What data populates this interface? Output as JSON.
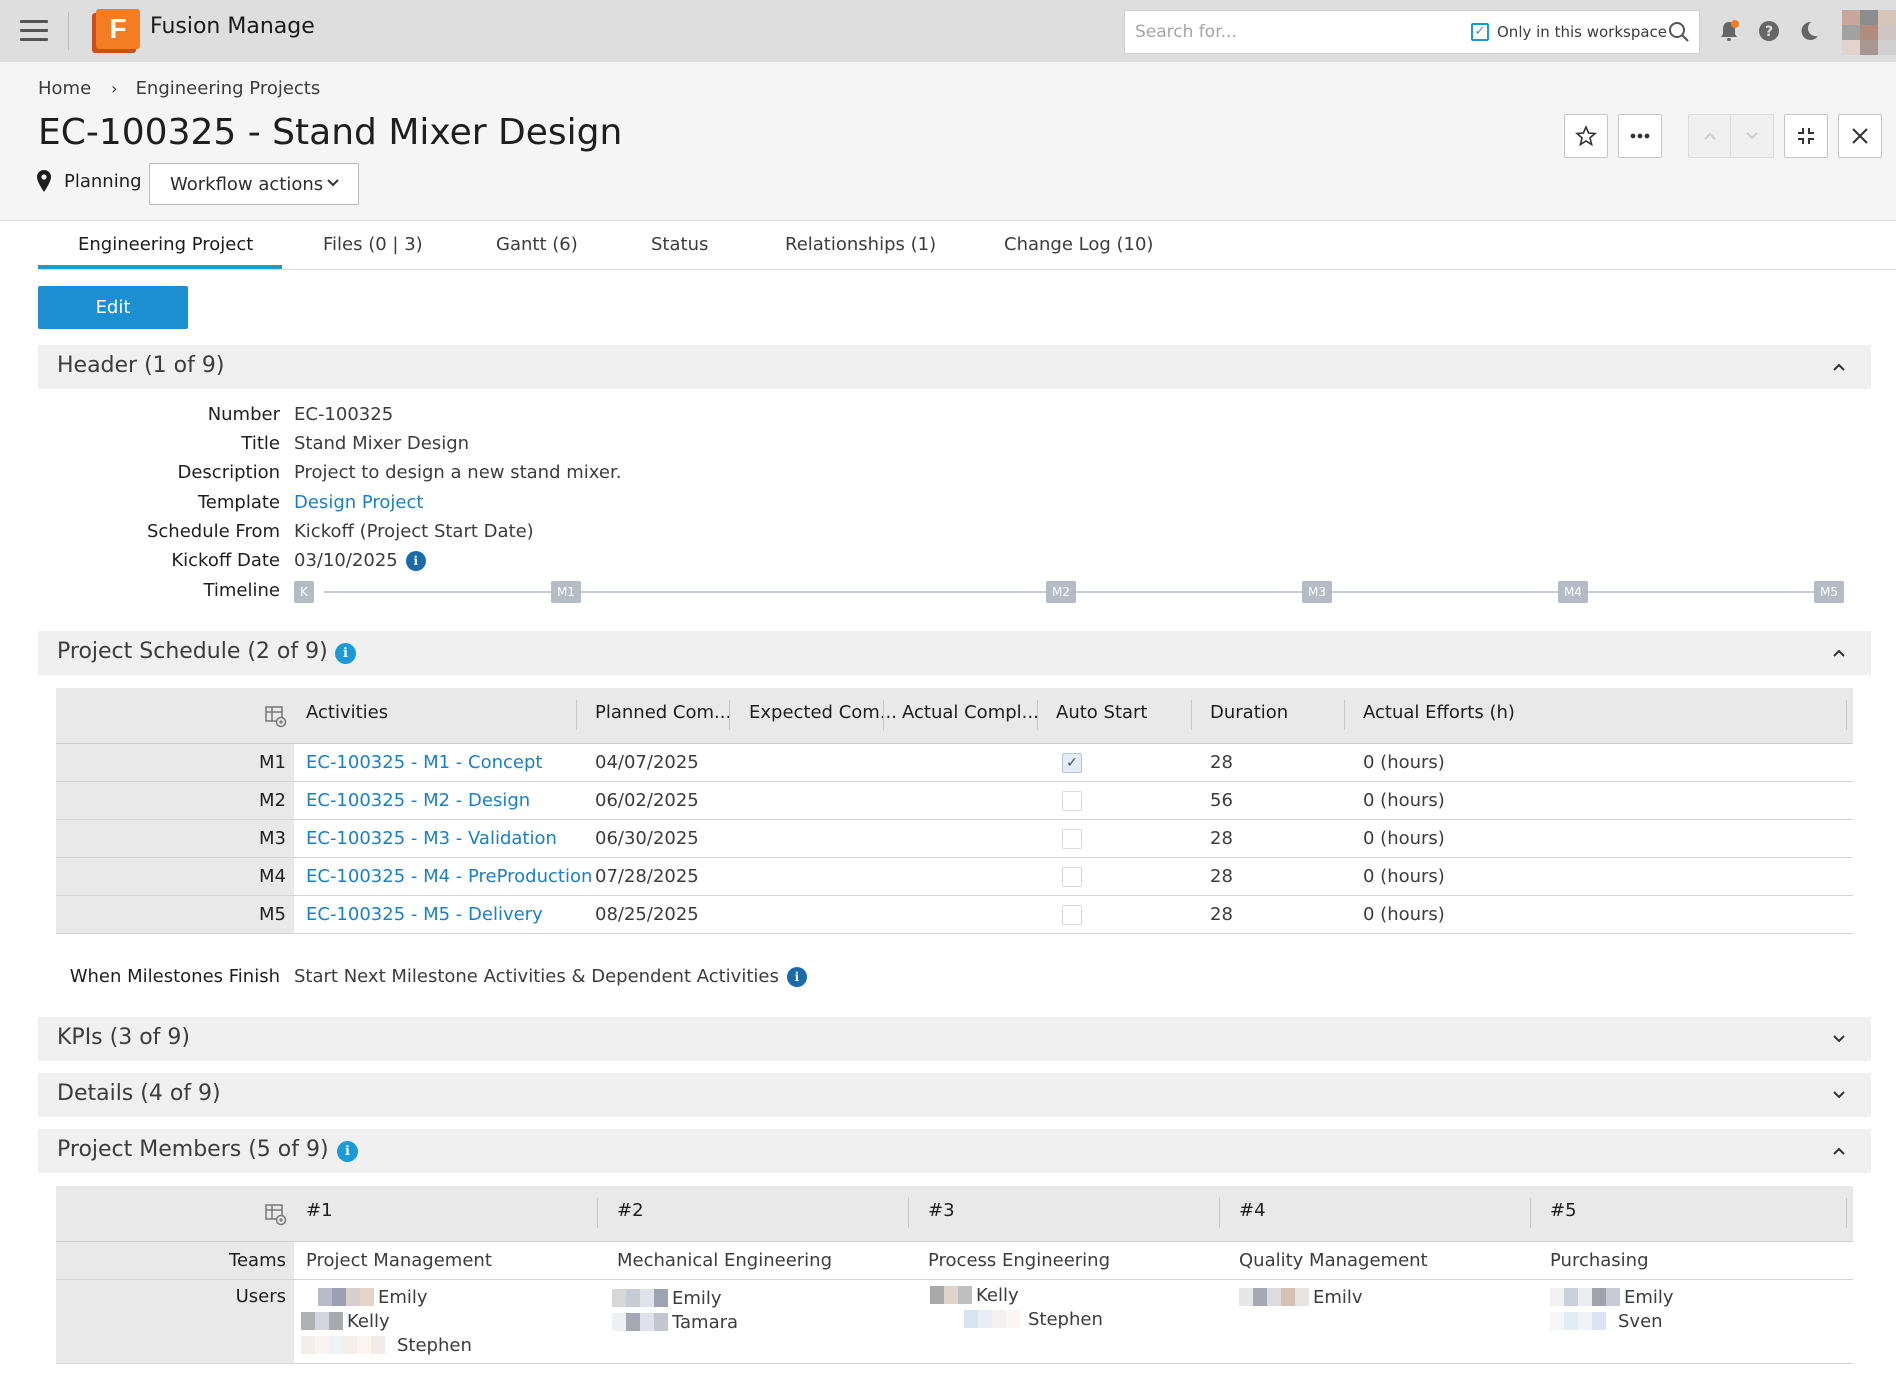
{
  "app": {
    "title": "Fusion Manage",
    "logo_letter": "F",
    "search_placeholder": "Search for...",
    "workspace_only_label": "Only in this workspace"
  },
  "breadcrumb": {
    "home": "Home",
    "workspace": "Engineering Projects"
  },
  "item": {
    "title": "EC-100325 - Stand Mixer Design",
    "state": "Planning",
    "workflow_button": "Workflow actions"
  },
  "tabs": [
    {
      "label": "Engineering Project",
      "active": true
    },
    {
      "label": "Files (0 | 3)"
    },
    {
      "label": "Gantt (6)"
    },
    {
      "label": "Status"
    },
    {
      "label": "Relationships (1)"
    },
    {
      "label": "Change Log (10)"
    }
  ],
  "edit_button": "Edit",
  "sections": {
    "header": {
      "title": "Header (1 of 9)",
      "fields": [
        {
          "label": "Number",
          "value": "EC-100325"
        },
        {
          "label": "Title",
          "value": "Stand Mixer Design"
        },
        {
          "label": "Description",
          "value": "Project to design a new stand mixer."
        },
        {
          "label": "Template",
          "value": "Design Project",
          "link": true
        },
        {
          "label": "Schedule From",
          "value": "Kickoff (Project Start Date)"
        },
        {
          "label": "Kickoff Date",
          "value": "03/10/2025"
        },
        {
          "label": "Timeline",
          "value": ""
        }
      ],
      "timeline_nodes": [
        "K",
        "M1",
        "M2",
        "M3",
        "M4",
        "M5"
      ]
    },
    "schedule": {
      "title": "Project Schedule (2 of 9)",
      "columns": [
        "Activities",
        "Planned Com...",
        "Expected Com...",
        "Actual Compl...",
        "Auto Start",
        "Duration",
        "Actual Efforts (h)"
      ],
      "rows": [
        {
          "id": "M1",
          "activity": "EC-100325 - M1 - Concept",
          "planned": "04/07/2025",
          "expected": "",
          "actual": "",
          "auto_start": true,
          "duration": "28",
          "efforts": "0 (hours)"
        },
        {
          "id": "M2",
          "activity": "EC-100325 - M2 - Design",
          "planned": "06/02/2025",
          "expected": "",
          "actual": "",
          "auto_start": false,
          "duration": "56",
          "efforts": "0 (hours)"
        },
        {
          "id": "M3",
          "activity": "EC-100325 - M3 - Validation",
          "planned": "06/30/2025",
          "expected": "",
          "actual": "",
          "auto_start": false,
          "duration": "28",
          "efforts": "0 (hours)"
        },
        {
          "id": "M4",
          "activity": "EC-100325 - M4 - PreProduction",
          "planned": "07/28/2025",
          "expected": "",
          "actual": "",
          "auto_start": false,
          "duration": "28",
          "efforts": "0 (hours)"
        },
        {
          "id": "M5",
          "activity": "EC-100325 - M5 - Delivery",
          "planned": "08/25/2025",
          "expected": "",
          "actual": "",
          "auto_start": false,
          "duration": "28",
          "efforts": "0 (hours)"
        }
      ],
      "milestone_label": "When Milestones Finish",
      "milestone_value": "Start Next Milestone Activities & Dependent Activities"
    },
    "kpis": {
      "title": "KPIs (3 of 9)"
    },
    "details": {
      "title": "Details (4 of 9)"
    },
    "members": {
      "title": "Project Members (5 of 9)",
      "columns": [
        "#1",
        "#2",
        "#3",
        "#4",
        "#5"
      ],
      "teams_label": "Teams",
      "users_label": "Users",
      "teams": [
        "Project Management",
        "Mechanical Engineering",
        "Process Engineering",
        "Quality Management",
        "Purchasing"
      ],
      "users": [
        [
          "Emily",
          "Kelly",
          "Stephen"
        ],
        [
          "Emily",
          "Tamara"
        ],
        [
          "Kelly",
          "Stephen"
        ],
        [
          "Emilv"
        ],
        [
          "Emily",
          "Sven"
        ]
      ]
    }
  },
  "colors": {
    "accent": "#1b9ad6",
    "link": "#1b7fc4",
    "logo": "#f47c22"
  }
}
